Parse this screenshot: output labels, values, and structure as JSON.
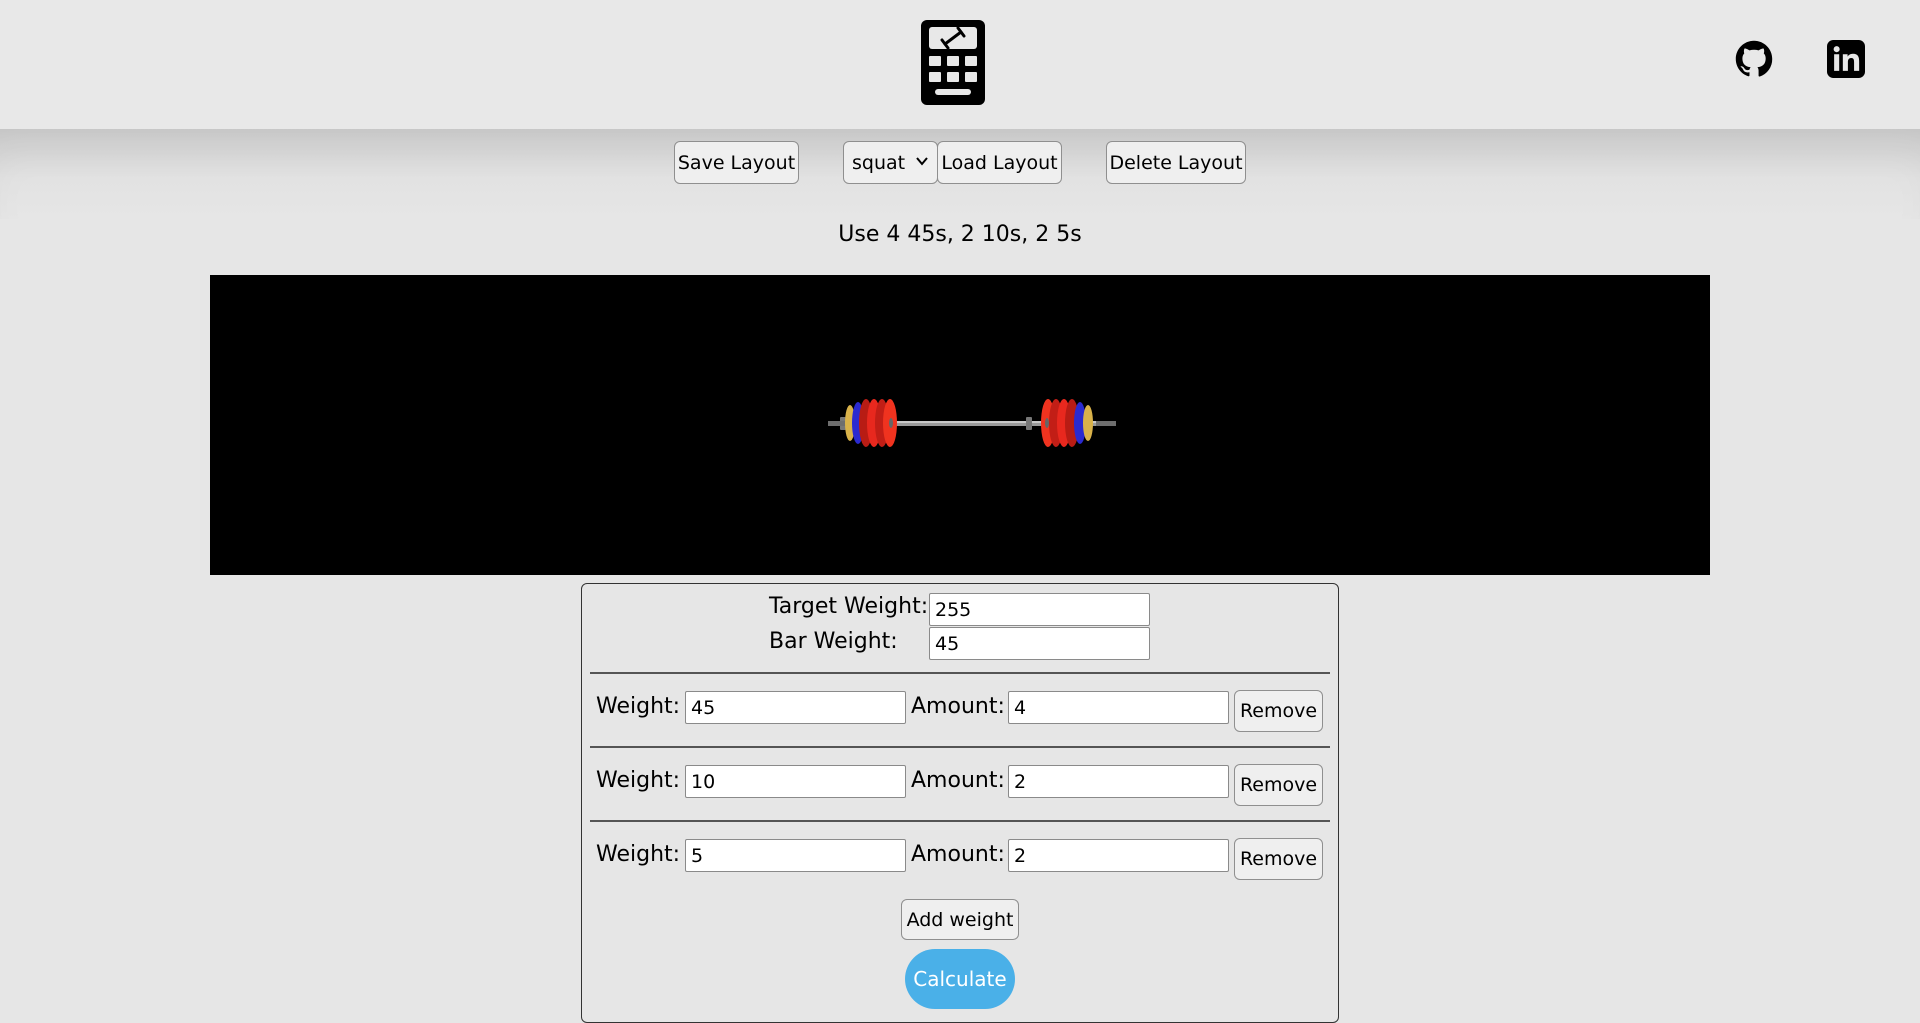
{
  "header": {
    "logo_icon": "calculator-dumbbell-icon",
    "github_icon": "github-icon",
    "linkedin_icon": "linkedin-icon"
  },
  "toolbar": {
    "save_label": "Save Layout",
    "layout_select_value": "squat",
    "load_label": "Load Layout",
    "delete_label": "Delete Layout"
  },
  "result_text": "Use 4 45s, 2 10s, 2 5s",
  "form": {
    "target_weight_label": "Target Weight:",
    "target_weight_value": "255",
    "bar_weight_label": "Bar Weight:",
    "bar_weight_value": "45",
    "weights": [
      {
        "weight_label": "Weight:",
        "weight": "45",
        "amount_label": "Amount:",
        "amount": "4",
        "remove_label": "Remove"
      },
      {
        "weight_label": "Weight:",
        "weight": "10",
        "amount_label": "Amount:",
        "amount": "2",
        "remove_label": "Remove"
      },
      {
        "weight_label": "Weight:",
        "weight": "5",
        "amount_label": "Amount:",
        "amount": "2",
        "remove_label": "Remove"
      }
    ],
    "add_weight_label": "Add weight",
    "calculate_label": "Calculate"
  },
  "colors": {
    "calculate_button": "#4ab0e8",
    "plate_45": "#e8281e",
    "plate_10": "#2a2ad0",
    "plate_5": "#d9b24a",
    "canvas_background": "#000000"
  }
}
